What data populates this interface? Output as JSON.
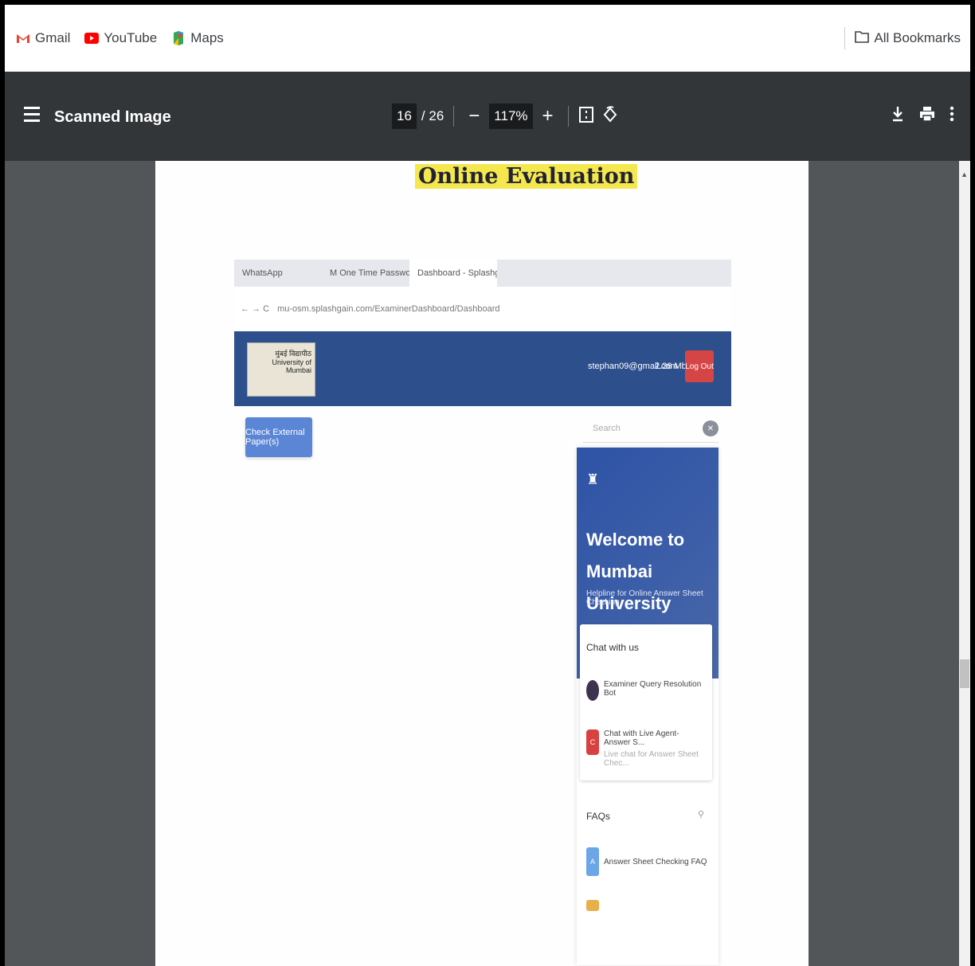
{
  "bookmarks": {
    "items": [
      {
        "label": "Gmail",
        "icon": "gmail-icon",
        "color": "#ea4335"
      },
      {
        "label": "YouTube",
        "icon": "youtube-icon",
        "color": "#ff0000"
      },
      {
        "label": "Maps",
        "icon": "maps-icon",
        "color": "#34a853"
      }
    ],
    "all_bookmarks": "All Bookmarks"
  },
  "pdf_toolbar": {
    "title": "Scanned Image",
    "page_current": "16",
    "page_total": "/ 26",
    "zoom": "117%",
    "minus": "−",
    "plus": "+"
  },
  "document": {
    "heading": "Online Evaluation",
    "embedded": {
      "tabs": [
        "WhatsApp",
        "M One Time Password (OTP) for O",
        "Dashboard - SplashgainOSM"
      ],
      "url": "mu-osm.splashgain.com/ExaminerDashboard/Dashboard",
      "university_logo_text": "मुंबई विद्यापीठ University of Mumbai",
      "user_email": "stephan09@gmail.com",
      "speed": "2.26 Mbps",
      "logout": "Log Out",
      "check_button": "Check External Paper(s)",
      "search_placeholder": "Search",
      "chat": {
        "welcome_title": "Welcome to Mumbai University",
        "welcome_sub": "Helpline for Online Answer Sheet Checking",
        "chat_with_us": "Chat with us",
        "bot_name": "Examiner Query Resolution Bot",
        "live_agent": "Chat with Live Agent- Answer S...",
        "live_agent_sub": "Live chat for Answer Sheet Chec...",
        "live_agent_badge": "C",
        "faqs": "FAQs",
        "faq_item": "Answer Sheet Checking FAQ",
        "faq_badge": "A"
      }
    }
  }
}
